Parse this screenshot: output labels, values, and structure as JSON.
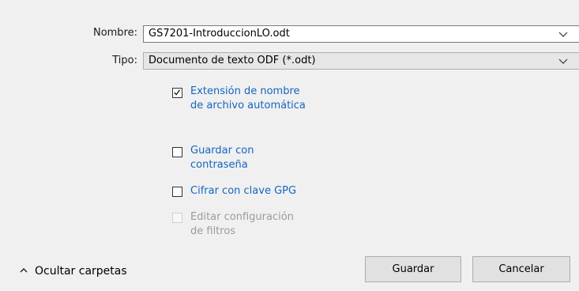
{
  "fields": {
    "name_label": "Nombre:",
    "name_value": "GS7201-IntroduccionLO.odt",
    "type_label": "Tipo:",
    "type_value": "Documento de texto ODF (*.odt)"
  },
  "options": [
    {
      "line1": "Extensión de nombre",
      "line2": "de archivo automática",
      "checked": true,
      "enabled": true
    },
    {
      "line1": "Guardar con",
      "line2": "contraseña",
      "checked": false,
      "enabled": true
    },
    {
      "line1": "Cifrar con clave GPG",
      "line2": "",
      "checked": false,
      "enabled": true
    },
    {
      "line1": "Editar configuración",
      "line2": "de filtros",
      "checked": false,
      "enabled": false
    }
  ],
  "footer": {
    "toggle_folders_label": "Ocultar carpetas",
    "save_label": "Guardar",
    "cancel_label": "Cancelar"
  },
  "icons": {
    "name_dropdown": "chevron-down-icon",
    "type_dropdown": "chevron-down-icon",
    "toggle_folders": "chevron-up-icon",
    "checkmark": "checkmark-icon"
  },
  "colors": {
    "link_text": "#1565c0",
    "disabled_text": "#9b9b9b",
    "dialog_bg": "#f0f0f0"
  }
}
